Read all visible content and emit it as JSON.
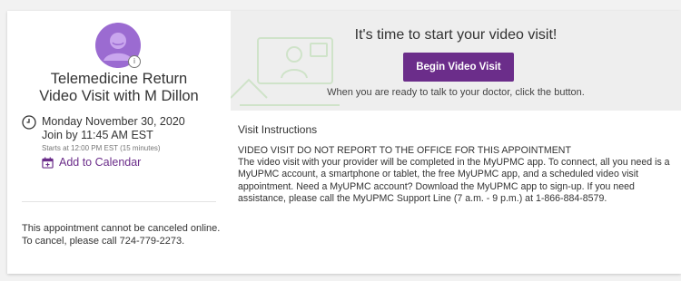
{
  "visit": {
    "title": "Telemedicine Return\nVideo Visit with M Dillon",
    "date": "Monday November 30, 2020",
    "join_by": "Join by 11:45 AM EST",
    "starts_at": "Starts at 12:00 PM EST (15 minutes)",
    "add_to_calendar": "Add to Calendar",
    "cancel_note": "This appointment cannot be canceled online. To cancel, please call 724-779-2273."
  },
  "banner": {
    "title": "It's time to start your video visit!",
    "button_label": "Begin Video Visit",
    "subtitle": "When you are ready to talk to your doctor, click the button."
  },
  "instructions": {
    "heading": "Visit Instructions",
    "line1": "VIDEO VISIT DO NOT REPORT TO THE OFFICE FOR THIS APPOINTMENT",
    "body": "The video visit with your provider will be completed in the MyUPMC app. To connect, all you need is a MyUPMC account, a smartphone or tablet, the free MyUPMC app, and a scheduled video visit appointment. Need a MyUPMC account? Download the MyUPMC app to sign-up. If you need assistance, please call the MyUPMC Support Line (7 a.m. - 9 p.m.) at 1-866-884-8579."
  },
  "colors": {
    "accent": "#6b2d8a",
    "avatar": "#9b6bd1",
    "banner_bg": "#eeeeee"
  },
  "icons": {
    "avatar": "user-avatar-icon",
    "info": "info-icon",
    "clock": "clock-icon",
    "calendar": "calendar-add-icon"
  }
}
